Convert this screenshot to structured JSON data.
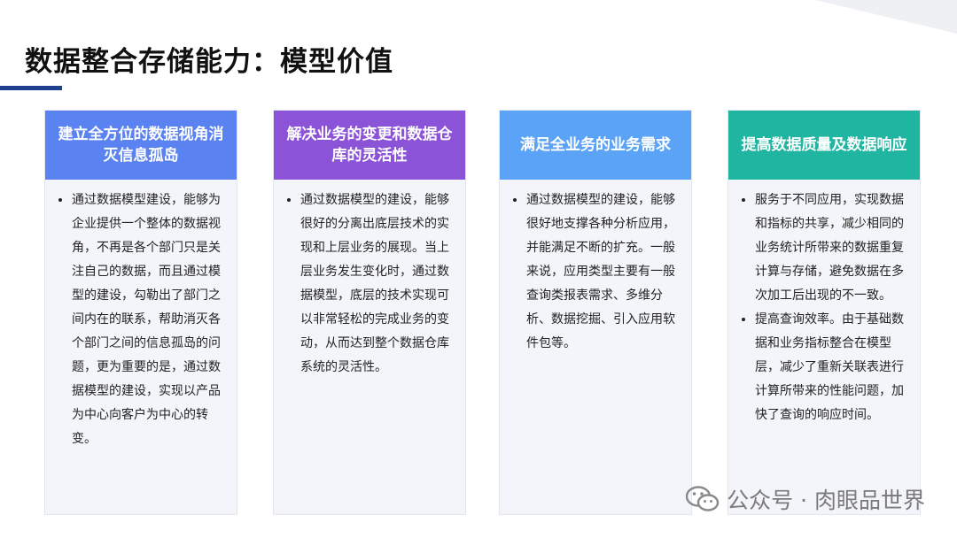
{
  "title": "数据整合存储能力：模型价值",
  "cards": [
    {
      "header": "建立全方位的数据视角消灭信息孤岛",
      "bullets": [
        "通过数据模型建设，能够为企业提供一个整体的数据视角，不再是各个部门只是关注自己的数据，而且通过模型的建设，勾勒出了部门之间内在的联系，帮助消灭各个部门之间的信息孤岛的问题，更为重要的是，通过数据模型的建设，实现以产品为中心向客户为中心的转变。"
      ]
    },
    {
      "header": "解决业务的变更和数据仓库的灵活性",
      "bullets": [
        "通过数据模型的建设，能够很好的分离出底层技术的实现和上层业务的展现。当上层业务发生变化时，通过数据模型，底层的技术实现可以非常轻松的完成业务的变动，从而达到整个数据仓库系统的灵活性。"
      ]
    },
    {
      "header": "满足全业务的业务需求",
      "bullets": [
        "通过数据模型的建设，能够很好地支撑各种分析应用，并能满足不断的扩充。一般来说，应用类型主要有一般查询类报表需求、多维分析、数据挖掘、引入应用软件包等。"
      ]
    },
    {
      "header": "提高数据质量及数据响应",
      "bullets": [
        "服务于不同应用，实现数据和指标的共享，减少相同的业务统计所带来的数据重复计算与存储，避免数据在多次加工后出现的不一致。",
        "提高查询效率。由于基础数据和业务指标整合在模型层，减少了重新关联表进行计算所带来的性能问题，加快了查询的响应时间。"
      ]
    }
  ],
  "watermark": "公众号 · 肉眼品世界",
  "icons": {
    "watermark": "wechat-icon"
  }
}
